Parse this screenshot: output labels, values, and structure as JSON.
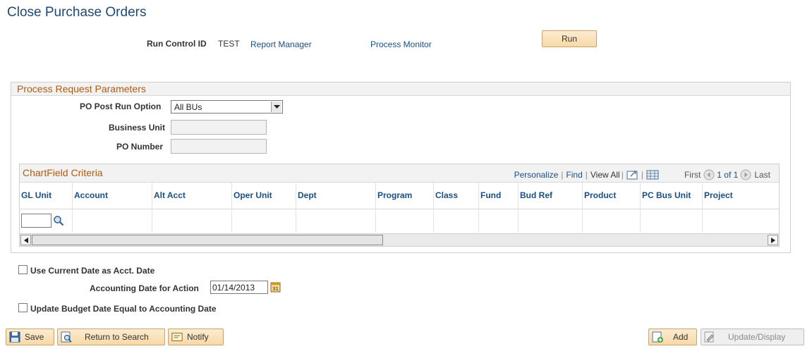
{
  "page": {
    "title": "Close Purchase Orders"
  },
  "run_control": {
    "label": "Run Control ID",
    "value": "TEST",
    "report_manager": "Report Manager",
    "process_monitor": "Process Monitor",
    "run_label": "Run"
  },
  "params": {
    "group_title": "Process Request Parameters",
    "po_post_run_option_label": "PO Post Run Option",
    "po_post_run_option_value": "All BUs",
    "business_unit_label": "Business Unit",
    "po_number_label": "PO Number"
  },
  "chartfield": {
    "title": "ChartField Criteria",
    "nav": {
      "personalize": "Personalize",
      "find": "Find",
      "view_all": "View All",
      "first": "First",
      "range": "1 of 1",
      "last": "Last"
    },
    "columns": [
      "GL Unit",
      "Account",
      "Alt Acct",
      "Oper Unit",
      "Dept",
      "Program",
      "Class",
      "Fund",
      "Bud Ref",
      "Product",
      "PC Bus Unit",
      "Project"
    ]
  },
  "options": {
    "use_current_date_label": "Use Current Date as Acct. Date",
    "accounting_date_label": "Accounting Date for Action",
    "accounting_date_value": "01/14/2013",
    "update_budget_label": "Update Budget Date Equal to Accounting Date"
  },
  "toolbar": {
    "save": "Save",
    "return_to_search": "Return to Search",
    "notify": "Notify",
    "add": "Add",
    "update_display": "Update/Display"
  }
}
